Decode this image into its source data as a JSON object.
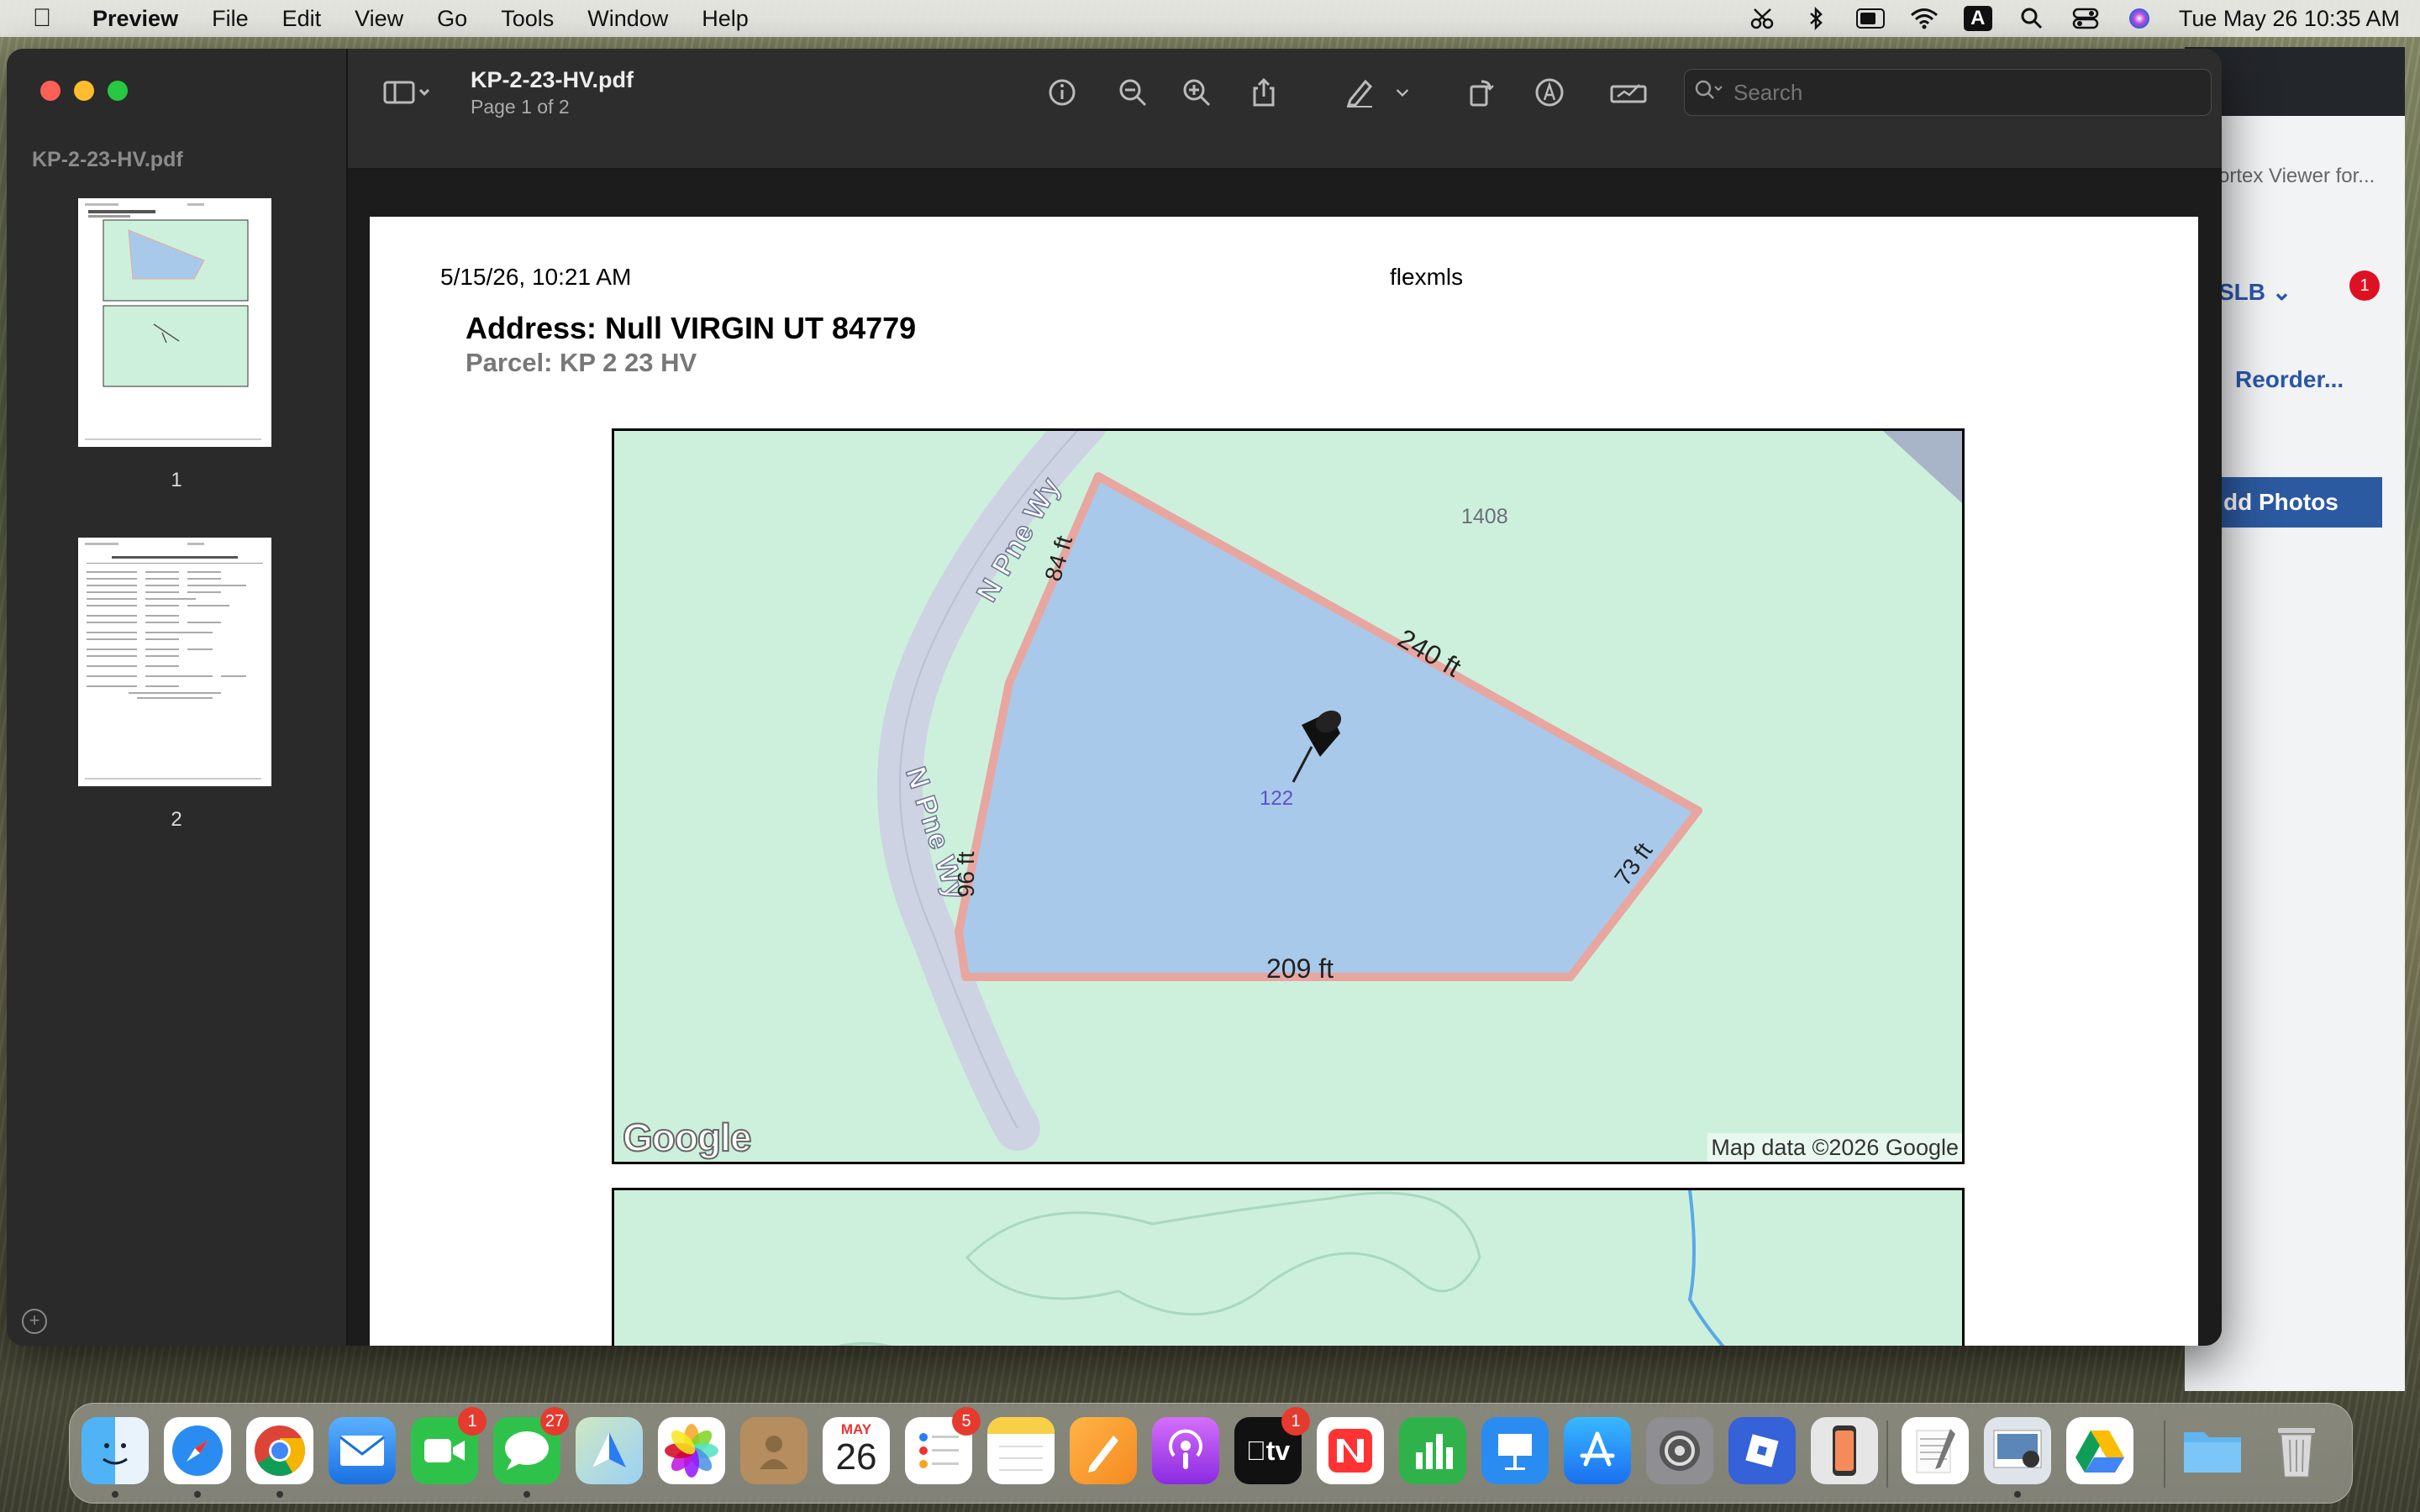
{
  "menubar": {
    "app": "Preview",
    "items": [
      "File",
      "Edit",
      "View",
      "Go",
      "Tools",
      "Window",
      "Help"
    ],
    "input_source": "A",
    "datetime": "Tue May 26  10:35 AM"
  },
  "background_app": {
    "tab_text": "ortex Viewer for...",
    "account": "SLB",
    "notification_count": "1",
    "reorder_label": "Reorder...",
    "add_photos_label": "dd Photos"
  },
  "window": {
    "sidebar_title": "KP-2-23-HV.pdf",
    "thumbnails": [
      {
        "label": "1"
      },
      {
        "label": "2"
      }
    ],
    "doc_title": "KP-2-23-HV.pdf",
    "page_indicator": "Page 1 of 2",
    "search_placeholder": "Search"
  },
  "page": {
    "header_date": "5/15/26, 10:21 AM",
    "header_brand": "flexmls",
    "address": "Address: Null VIRGIN UT 84779",
    "parcel": "Parcel: KP 2 23 HV"
  },
  "map": {
    "road_label_top": "N Pne Wy",
    "road_label_mid": "N Pne Wy",
    "parcel_number": "1408",
    "pin_label": "122",
    "edge_top_left": "84 ft",
    "edge_top": "240 ft",
    "edge_right": "73 ft",
    "edge_bottom": "209 ft",
    "edge_left": "96 ft",
    "logo": "Google",
    "attribution": "Map data ©2026 Google",
    "colors": {
      "land": "#cdf0dc",
      "parcel_fill": "#a9c9ea",
      "parcel_outline": "#e8a6a0",
      "road": "#cdd3e2"
    }
  },
  "dock": {
    "badges": {
      "facetime": "1",
      "messages": "27",
      "reminders": "5",
      "tv": "1"
    },
    "calendar_month": "MAY",
    "calendar_day": "26",
    "tv_label": "tv"
  }
}
